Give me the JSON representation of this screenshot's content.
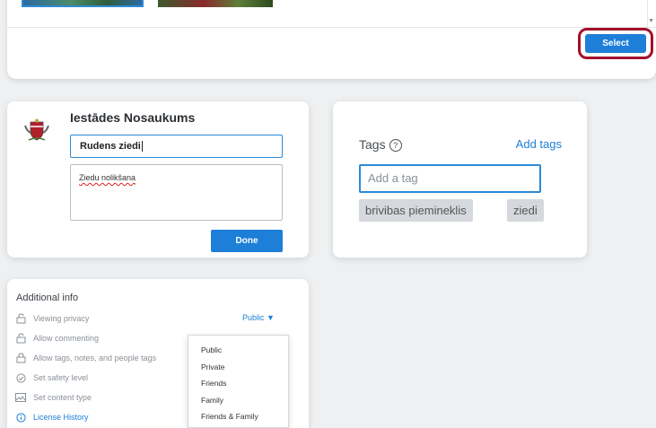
{
  "toolbar": {
    "select_label": "Select"
  },
  "title_card": {
    "org_name": "Iestādes Nosaukums",
    "title_value": "Rudens ziedi",
    "description_value": "Ziedu nolikšana",
    "done_label": "Done"
  },
  "tags_card": {
    "label": "Tags",
    "help_glyph": "?",
    "add_tags_label": "Add tags",
    "input_placeholder": "Add a tag",
    "tags": [
      "brivibas piemineklis",
      "ziedi"
    ]
  },
  "info_card": {
    "heading": "Additional info",
    "privacy_value": "Public",
    "rows": [
      "Viewing privacy",
      "Allow commenting",
      "Allow tags, notes, and people tags",
      "Set safety level",
      "Set content type",
      "License History"
    ],
    "dropdown_options": [
      "Public",
      "Private",
      "Friends",
      "Family",
      "Friends & Family"
    ]
  },
  "colors": {
    "accent": "#1d7fd8",
    "highlight_ring": "#a3102a"
  }
}
